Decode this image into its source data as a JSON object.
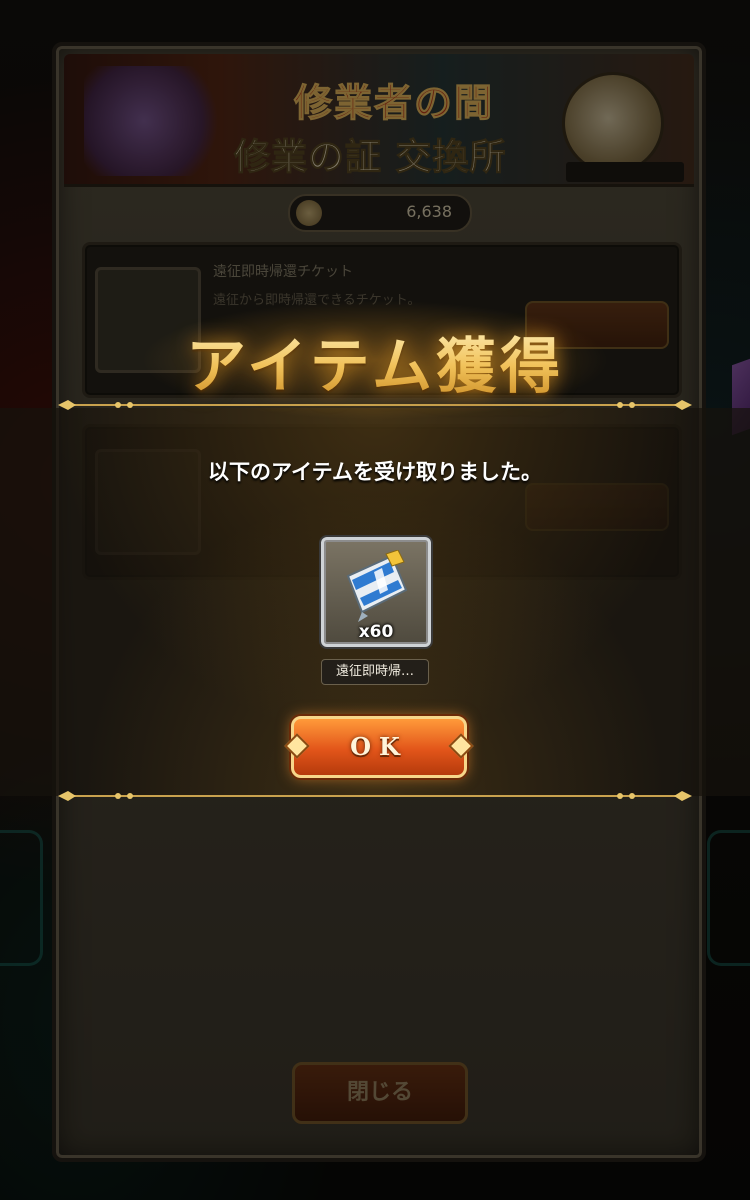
{
  "exchange": {
    "banner_title": "修業者の間",
    "banner_subtitle": "修業の証 交換所",
    "banner_period": "",
    "currency_value": "6,638",
    "rows": [
      {
        "name": "遠征即時帰還チケット",
        "desc": "遠征から即時帰還できるチケット。",
        "price": "",
        "limit": ""
      },
      {
        "name": "",
        "desc": "",
        "price": "",
        "limit": ""
      }
    ],
    "close_label": "閉じる"
  },
  "popup": {
    "title": "アイテム獲得",
    "message": "以下のアイテムを受け取りました。",
    "item": {
      "quantity": "x60",
      "name": "遠征即時帰…",
      "icon": "ticket-icon"
    },
    "ok_label": "OK"
  },
  "colors": {
    "accent_gold": "#f1c25a",
    "ok_button": "#e2551a"
  }
}
